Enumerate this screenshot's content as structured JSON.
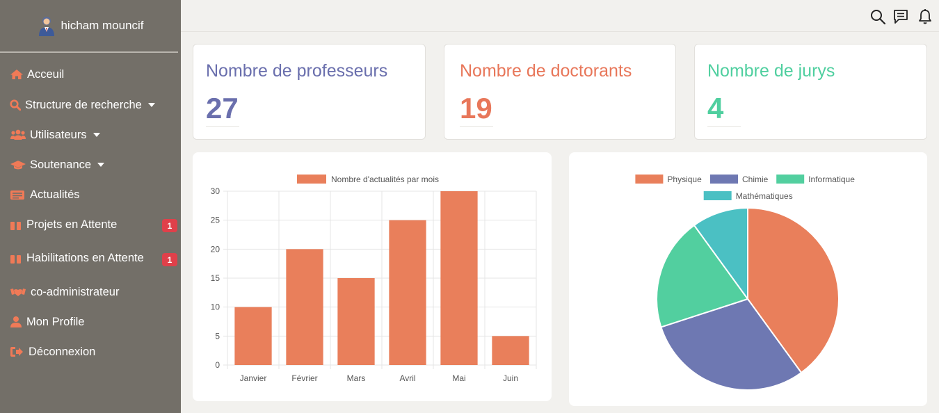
{
  "sidebar": {
    "user_name": "hicham mouncif",
    "items": [
      {
        "label": "Acceuil",
        "icon": "home-icon"
      },
      {
        "label": "Structure de recherche",
        "icon": "search-icon",
        "dropdown": true
      },
      {
        "label": "Utilisateurs",
        "icon": "users-icon",
        "dropdown": true
      },
      {
        "label": "Soutenance",
        "icon": "graduation-cap-icon",
        "dropdown": true
      },
      {
        "label": "Actualités",
        "icon": "newspaper-icon"
      },
      {
        "label": "Projets en Attente",
        "icon": "pause-icon",
        "badge": "1"
      },
      {
        "label": "Habilitations en Attente",
        "icon": "pause-icon",
        "badge": "1"
      },
      {
        "label": "co-administrateur",
        "icon": "handshake-icon"
      },
      {
        "label": "Mon Profile",
        "icon": "user-icon"
      },
      {
        "label": "Déconnexion",
        "icon": "sign-out-icon"
      }
    ]
  },
  "topbar": {
    "icons": [
      "search-icon",
      "message-icon",
      "bell-icon"
    ]
  },
  "stats": [
    {
      "label": "Nombre de professeurs",
      "value": "27",
      "color": "#6a6fad"
    },
    {
      "label": "Nombre de doctorants",
      "value": "19",
      "color": "#e8775a"
    },
    {
      "label": "Nombre de jurys",
      "value": "4",
      "color": "#4fcf9f"
    }
  ],
  "colors": {
    "sidebar_bg": "#736f68",
    "bar": "#e97f5b",
    "badge": "#e0404a"
  },
  "chart_data": [
    {
      "type": "bar",
      "categories": [
        "Janvier",
        "Février",
        "Mars",
        "Avril",
        "Mai",
        "Juin"
      ],
      "series": [
        {
          "name": "Nombre d'actualités par mois",
          "values": [
            10,
            20,
            15,
            25,
            30,
            5
          ],
          "color": "#e97f5b"
        }
      ],
      "ylim": [
        0,
        30
      ],
      "yticks": [
        0,
        5,
        10,
        15,
        20,
        25,
        30
      ],
      "legend": "top",
      "grid": true
    },
    {
      "type": "pie",
      "labels": [
        "Physique",
        "Chimie",
        "Informatique",
        "Mathématiques"
      ],
      "values": [
        40,
        30,
        20,
        10
      ],
      "colors": [
        "#e97f5b",
        "#6e78b2",
        "#52cf9f",
        "#4bc0c3"
      ],
      "legend": "top"
    }
  ]
}
